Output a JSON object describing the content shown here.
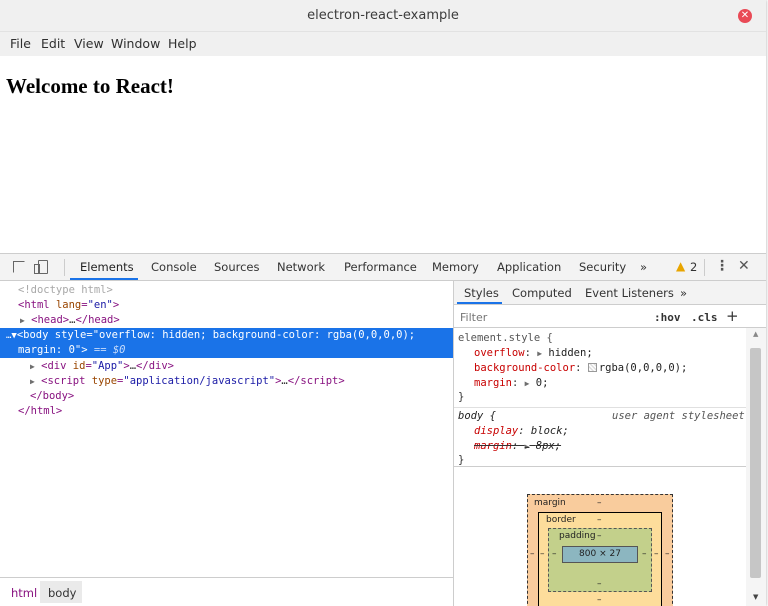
{
  "window": {
    "title": "electron-react-example",
    "close_glyph": "✕"
  },
  "menu": [
    "File",
    "Edit",
    "View",
    "Window",
    "Help"
  ],
  "page": {
    "heading": "Welcome to React!"
  },
  "devtools": {
    "tabs": [
      "Elements",
      "Console",
      "Sources",
      "Network",
      "Performance",
      "Memory",
      "Application",
      "Security"
    ],
    "active_tab": "Elements",
    "more": "»",
    "warning_count": "2",
    "kebab": "⋮",
    "close": "✕",
    "dom": {
      "doctype": "<!doctype html>",
      "html_open_tag": "html",
      "html_attr": "lang",
      "html_attr_val": "\"en\"",
      "head": "head",
      "head_ellipsis": "…",
      "body_line1": "<body style=\"overflow: hidden; background-color: rgba(0,0,0,0);",
      "body_line2": "margin: 0\">",
      "body_eq": "== $0",
      "div_tag": "div",
      "div_attr": "id",
      "div_val": "\"App\"",
      "script_tag": "script",
      "script_attr": "type",
      "script_val": "\"application/javascript\"",
      "body_close": "</body>",
      "html_close": "</html>"
    },
    "breadcrumbs": [
      "html",
      "body"
    ],
    "styles": {
      "tabs": [
        "Styles",
        "Computed",
        "Event Listeners"
      ],
      "more": "»",
      "filter_placeholder": "Filter",
      "hov": ":hov",
      "cls": ".cls",
      "plus": "+",
      "element_style": {
        "selector": "element.style {",
        "props": [
          {
            "name": "overflow",
            "value": "hidden;"
          },
          {
            "name": "background-color",
            "value": "rgba(0,0,0,0);"
          },
          {
            "name": "margin",
            "value": "0;"
          }
        ],
        "close": "}"
      },
      "ua_rule": {
        "selector": "body {",
        "source": "user agent stylesheet",
        "props": [
          {
            "name": "display",
            "value": "block;"
          },
          {
            "name": "margin",
            "value": "8px;"
          }
        ],
        "close": "}"
      },
      "box_model": {
        "margin_label": "margin",
        "border_label": "border",
        "padding_label": "padding",
        "dash": "–",
        "content": "800 × 27"
      }
    },
    "colors": {
      "accent": "#1a73e8",
      "warning": "#e8a500",
      "close_red": "#e94a56"
    }
  }
}
